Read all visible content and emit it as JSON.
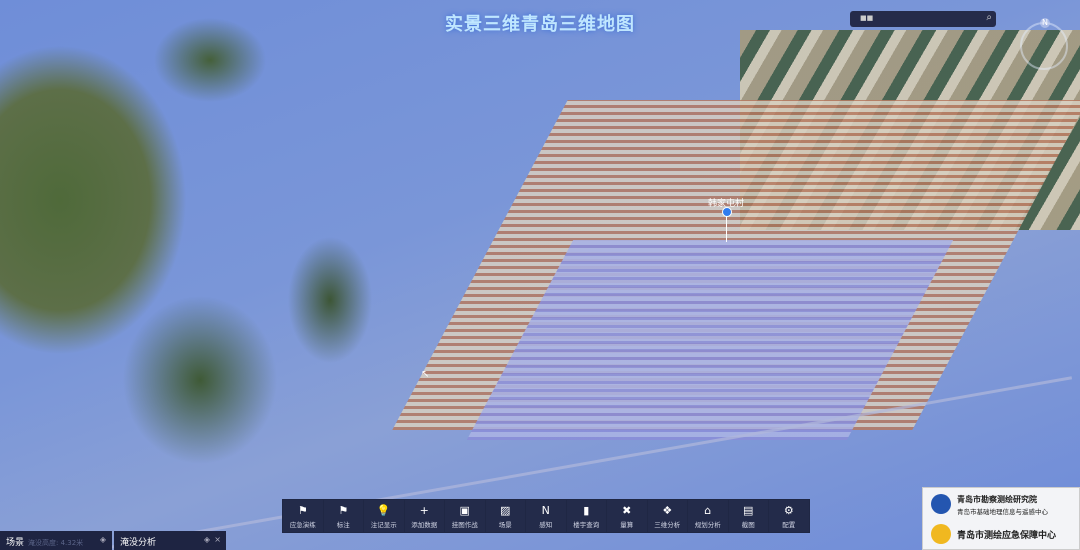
{
  "title": "实景三维青岛三维地图",
  "search": {
    "placeholder": "■■",
    "icon": "search-icon"
  },
  "compass": {
    "north": "N"
  },
  "map": {
    "marker_label": "韩家屯村"
  },
  "toolbar": [
    {
      "label": "应急演练",
      "icon": "⚑"
    },
    {
      "label": "标注",
      "icon": "⚑"
    },
    {
      "label": "注记显示",
      "icon": "💡"
    },
    {
      "label": "添加数据",
      "icon": "+"
    },
    {
      "label": "挂图作战",
      "icon": "▣"
    },
    {
      "label": "场景",
      "icon": "▨"
    },
    {
      "label": "感知",
      "icon": "N"
    },
    {
      "label": "楼宇查询",
      "icon": "▮"
    },
    {
      "label": "量算",
      "icon": "✖"
    },
    {
      "label": "三维分析",
      "icon": "❖"
    },
    {
      "label": "规划分析",
      "icon": "⌂"
    },
    {
      "label": "截图",
      "icon": "▤"
    },
    {
      "label": "配置",
      "icon": "⚙"
    }
  ],
  "panels": {
    "scene": {
      "title": "场景",
      "sub": "淹没高度: 4.32米"
    },
    "flood": {
      "title": "淹没分析"
    }
  },
  "logos": {
    "org1": "青岛市勘察测绘研究院",
    "org1_sub": "青岛市基础地理信息与遥感中心",
    "org2": "青岛市测绘应急保障中心"
  }
}
